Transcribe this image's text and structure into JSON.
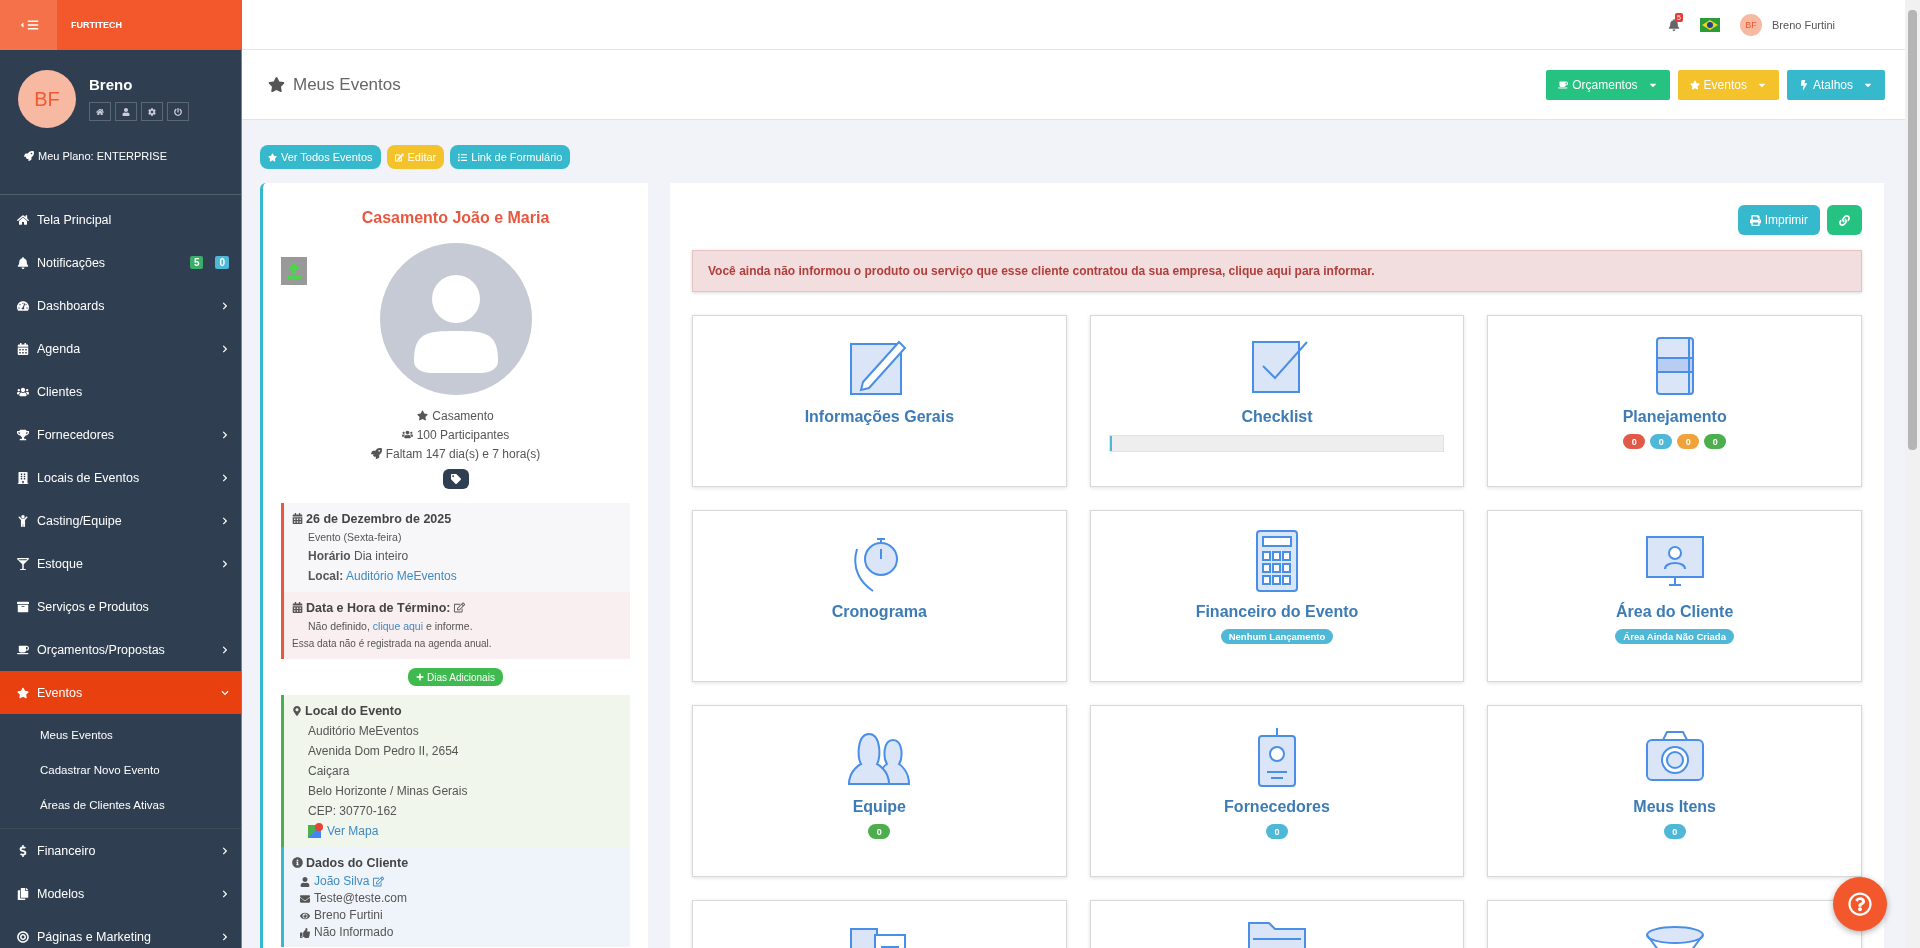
{
  "brand": "FURTITECH",
  "user": {
    "initials": "BF",
    "name": "Breno",
    "plan": "Meu Plano: ENTERPRISE"
  },
  "sidebar": {
    "items": [
      {
        "label": "Tela Principal",
        "selected": false
      },
      {
        "label": "Notificações",
        "selected": false,
        "badges": [
          {
            "text": "5",
            "color": "#3aaf6a"
          },
          {
            "text": "0",
            "color": "#4fb8d6"
          }
        ]
      },
      {
        "label": "Dashboards",
        "selected": false,
        "expanded": false
      },
      {
        "label": "Agenda",
        "selected": false,
        "expanded": false
      },
      {
        "label": "Clientes",
        "selected": false
      },
      {
        "label": "Fornecedores",
        "selected": false,
        "expanded": false
      },
      {
        "label": "Locais de Eventos",
        "selected": false,
        "expanded": false
      },
      {
        "label": "Casting/Equipe",
        "selected": false,
        "expanded": false
      },
      {
        "label": "Estoque",
        "selected": false,
        "expanded": false
      },
      {
        "label": "Serviços e Produtos",
        "selected": false
      },
      {
        "label": "Orçamentos/Propostas",
        "selected": false,
        "expanded": false
      },
      {
        "label": "Eventos",
        "selected": true,
        "expanded": true,
        "children": [
          {
            "label": "Meus Eventos"
          },
          {
            "label": "Cadastrar Novo Evento"
          },
          {
            "label": "Áreas de Clientes Ativas"
          }
        ]
      },
      {
        "label": "Financeiro",
        "selected": false,
        "expanded": false
      },
      {
        "label": "Modelos",
        "selected": false,
        "expanded": false
      },
      {
        "label": "Páginas e Marketing",
        "selected": false,
        "expanded": false
      }
    ]
  },
  "topbar": {
    "notification_count": "5",
    "user_initials": "BF",
    "user_name": "Breno Furtini"
  },
  "page_title": "Meus Eventos",
  "header_buttons": [
    {
      "label": "Orçamentos",
      "color": "#26c281"
    },
    {
      "label": "Eventos",
      "color": "#f4c22b"
    },
    {
      "label": "Atalhos",
      "color": "#36b9cc"
    }
  ],
  "action_buttons": [
    {
      "label": "Ver Todos Eventos",
      "color": "#36b9cc"
    },
    {
      "label": "Editar",
      "color": "#f4c22b"
    },
    {
      "label": "Link de Formulário",
      "color": "#36b9cc"
    }
  ],
  "event": {
    "title": "Casamento João e Maria",
    "facts": [
      "Casamento",
      "100 Participantes",
      "Faltam 147 dia(s) e 7 hora(s)"
    ],
    "date": {
      "title": "26 de Dezembro de 2025",
      "subtitle": "Evento (Sexta-feira)",
      "lines": [
        {
          "label": "Horário",
          "value": "Dia inteiro",
          "link": false
        },
        {
          "label": "Local:",
          "value": "Auditório MeEventos",
          "link": true
        }
      ]
    },
    "end": {
      "title": "Data e Hora de Término:",
      "before": "Não definido, ",
      "link": "clique aqui",
      "after": " e informe.",
      "note": "Essa data não é registrada na agenda anual."
    },
    "extra_days_button": "Dias Adicionais",
    "location": {
      "title": "Local do Evento",
      "lines": [
        "Auditório MeEventos",
        "Avenida Dom Pedro II, 2654",
        "Caiçara",
        "Belo Horizonte / Minas Gerais",
        "CEP: 30770-162"
      ],
      "map_link": "Ver Mapa"
    },
    "client": {
      "title": "Dados do Cliente",
      "name": "João Silva",
      "email": "Teste@teste.com",
      "responsible": "Breno Furtini",
      "phone": "Não Informado"
    }
  },
  "print_button": "Imprimir",
  "alert": "Você ainda não informou o produto ou serviço que esse cliente contratou da sua empresa, clique aqui para informar.",
  "tiles": [
    {
      "title": "Informações Gerais",
      "kind": "plain"
    },
    {
      "title": "Checklist",
      "kind": "progress",
      "level": 0
    },
    {
      "title": "Planejamento",
      "kind": "counters",
      "counters": [
        {
          "text": "0",
          "color": "#e05a47"
        },
        {
          "text": "0",
          "color": "#4fb8d6"
        },
        {
          "text": "0",
          "color": "#f0a33a"
        },
        {
          "text": "0",
          "color": "#4cae4c"
        }
      ]
    },
    {
      "title": "Cronograma",
      "kind": "plain"
    },
    {
      "title": "Financeiro do Evento",
      "kind": "tag",
      "tag": "Nenhum Lançamento"
    },
    {
      "title": "Área do Cliente",
      "kind": "tag",
      "tag": "Área Ainda Não Criada"
    },
    {
      "title": "Equipe",
      "kind": "counters",
      "counters": [
        {
          "text": "0",
          "color": "#4cae4c"
        }
      ]
    },
    {
      "title": "Fornecedores",
      "kind": "counters",
      "counters": [
        {
          "text": "0",
          "color": "#4fb8d6"
        }
      ]
    },
    {
      "title": "Meus Itens",
      "kind": "counters",
      "counters": [
        {
          "text": "0",
          "color": "#4fb8d6"
        }
      ]
    },
    {
      "kind": "cut"
    },
    {
      "kind": "cut"
    },
    {
      "kind": "cut"
    }
  ]
}
